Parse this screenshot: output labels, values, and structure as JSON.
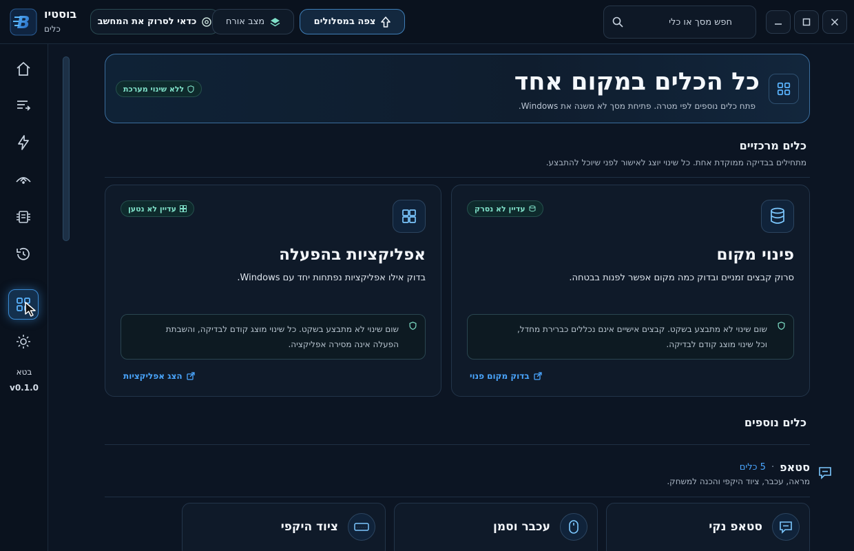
{
  "app": {
    "name": "בוסטיו",
    "subtitle": "כלים"
  },
  "topbar": {
    "search_placeholder": "חפש מסך או כלי",
    "routes_button": "צפה במסלולים",
    "guest_mode": "מצב אורח",
    "scan_prompt": "כדאי לסרוק את המחשב"
  },
  "sidebar": {
    "items": [
      {
        "icon": "home-icon"
      },
      {
        "icon": "list-arrow-icon"
      },
      {
        "icon": "bolt-icon"
      },
      {
        "icon": "network-icon"
      },
      {
        "icon": "chip-icon"
      },
      {
        "icon": "history-icon"
      },
      {
        "icon": "grid-icon",
        "active": true
      },
      {
        "icon": "sun-icon"
      }
    ],
    "channel": "בטא",
    "version": "v0.1.0"
  },
  "hero": {
    "title": "כל הכלים במקום אחד",
    "description": "פתח כלים נוספים לפי מטרה. פתיחת מסך לא משנה את Windows.",
    "badge": "ללא שינוי מערכת"
  },
  "core_tools": {
    "title": "כלים מרכזיים",
    "description": "מתחילים בבדיקה ממוקדת אחת. כל שינוי יוצג לאישור לפני שיוכל להתבצע.",
    "cards": [
      {
        "title": "פינוי מקום",
        "description": "סרוק קבצים זמניים ובדוק כמה מקום אפשר לפנות בבטחה.",
        "badge": "עדיין לא נסרק",
        "note_line1": "שום שינוי לא מתבצע בשקט. קבצים אישיים אינם נכללים כברירת מחדל,",
        "note_line2": "וכל שינוי מוצג קודם לבדיקה.",
        "link": "בדוק מקום פנוי"
      },
      {
        "title": "אפליקציות בהפעלה",
        "description": "בדוק אילו אפליקציות נפתחות יחד עם Windows.",
        "badge": "עדיין לא נטען",
        "note_line1": "שום שינוי לא מתבצע בשקט. כל שינוי מוצג קודם לבדיקה, והשבתת",
        "note_line2": "הפעלה אינה מסירה אפליקציה.",
        "link": "הצג אפליקציות"
      }
    ]
  },
  "more_tools": {
    "title": "כלים נוספים",
    "group": {
      "name": "סטאפ",
      "separator": "·",
      "count": "5 כלים",
      "description": "מראה, עכבר, ציוד היקפי והכנה למשחק."
    },
    "items": [
      {
        "title": "סטאפ נקי",
        "icon": "chat-icon"
      },
      {
        "title": "עכבר וסמן",
        "icon": "mouse-icon"
      },
      {
        "title": "ציוד היקפי",
        "icon": "keyboard-icon"
      }
    ]
  },
  "colors": {
    "accent": "#4aa6ff",
    "badge_text": "#7fe0c8",
    "background": "#0c1523"
  }
}
